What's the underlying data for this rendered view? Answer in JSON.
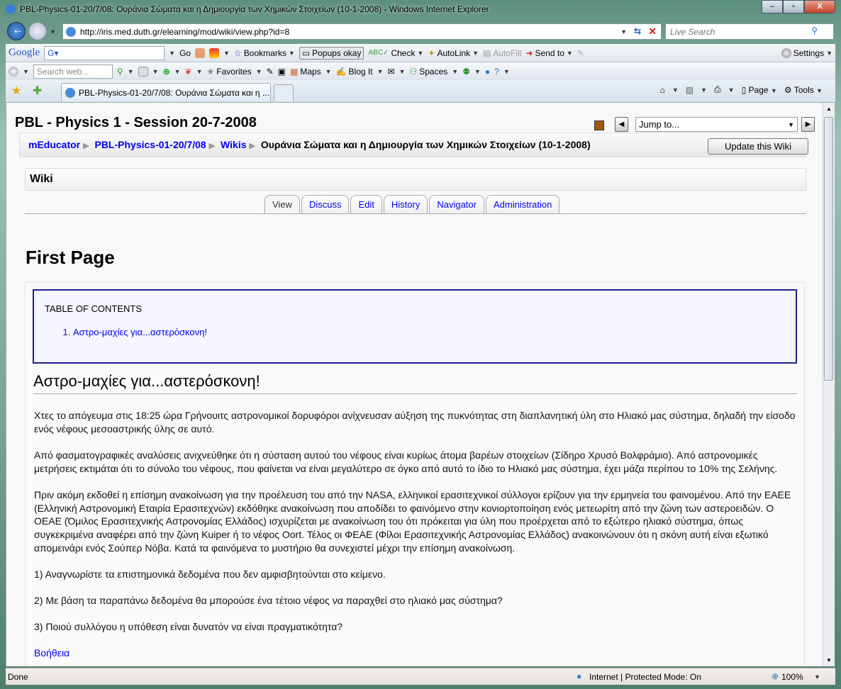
{
  "window": {
    "title": "PBL-Physics-01-20/7/08: Ουράνια Σώματα και η Δημιουργία των Χημικών Στοιχείων (10-1-2008) - Windows Internet Explorer",
    "minimize": "–",
    "maximize": "▫",
    "close": "X"
  },
  "address": {
    "url": "http://iris.med.duth.gr/elearning/mod/wiki/view.php?id=8",
    "search_placeholder": "Live Search"
  },
  "google_toolbar": {
    "logo": "Google",
    "go": "Go",
    "bookmarks": "Bookmarks",
    "popups": "Popups okay",
    "check": "Check",
    "autolink": "AutoLink",
    "autofill": "AutoFill",
    "sendto": "Send to",
    "settings": "Settings"
  },
  "msn_toolbar": {
    "search_placeholder": "Search web...",
    "favorites": "Favorites",
    "maps": "Maps",
    "blogit": "Blog It",
    "spaces": "Spaces"
  },
  "tabs_bar": {
    "tab_title": "PBL-Physics-01-20/7/08: Ουράνια Σώματα και η ...",
    "page": "Page",
    "tools": "Tools"
  },
  "page": {
    "title": "PBL - Physics 1 - Session 20-7-2008",
    "jump_to": "Jump to...",
    "breadcrumb": [
      "mEducator",
      "PBL-Physics-01-20/7/08",
      "Wikis"
    ],
    "breadcrumb_current": "Ουράνια Σώματα και η Δημιουργία των Χημικών Στοιχείων (10-1-2008)",
    "update_button": "Update this Wiki",
    "wiki_heading": "Wiki",
    "tabs": [
      "View",
      "Discuss",
      "Edit",
      "History",
      "Navigator",
      "Administration"
    ],
    "active_tab": "View",
    "page_heading": "First Page",
    "toc_title": "TABLE OF CONTENTS",
    "toc_items": [
      "Αστρο-μαχίες για...αστερόσκονη!"
    ],
    "section_heading": "Αστρο-μαχίες για...αστερόσκονη!",
    "paragraphs": [
      "Χτες το απόγευμα στις 18:25 ώρα Γρήνουιτς αστρονομικοί δορυφόροι ανίχνευσαν αύξηση της πυκνότητας στη διαπλανητική ύλη στο Ηλιακό μας σύστημα, δηλαδή την είσοδο ενός νέφους μεσοαστρικής ύλης σε αυτό.",
      "Από φασματογραφικές αναλύσεις ανιχνεύθηκε ότι η σύσταση αυτού του νέφους είναι κυρίως άτομα βαρέων στοιχείων (Σίδηρο Χρυσό Βολφράμιο). Από αστρονομικές μετρήσεις εκτιμάται ότι το σύνολο του νέφους, που φαίνεται να είναι μεγαλύτερο σε όγκο από αυτό το ίδιο το Ηλιακό μας σύστημα, έχει μάζα περίπου το 10% της Σελήνης.",
      "Πριν ακόμη εκδοθεί η επίσημη ανακοίνωση για την προέλευση του από την NASA, ελληνικοί ερασιτεχνικοί σύλλογοι ερίζουν για την ερμηνεία του φαινομένου. Από την ΕΑΕΕ (Ελληνική Αστρονομική Εταιρία Ερασιτεχνών) εκδόθηκε ανακοίνωση που αποδίδει το φαινόμενο στην κονιορτοποίηση ενός μετεωρίτη από την ζώνη των αστεροειδών. Ο ΟΕΑΕ (Όμιλος Ερασιτεχνικής Αστρονομίας Ελλάδος) ισχυρίζεται με ανακοίνωση του ότι πρόκειται για ύλη που προέρχεται από το εξώτερο ηλιακό σύστημα, όπως συγκεκριμένα αναφέρει από την ζώνη Kuiper ή το νέφος Oort. Τέλος οι ΦΕΑΕ (Φίλοι Ερασιτεχνικής Αστρονομίας Ελλάδος) ανακοινώνουν ότι η σκόνη αυτή είναι εξωτικό απομεινάρι ενός Σούπερ Νόβα. Κατά τα φαινόμενα το μυστήριο θα συνεχιστεί μέχρι την επίσημη ανακοίνωση.",
      "1) Αναγνωρίστε τα επιστημονικά δεδομένα που δεν αμφισβητούνται στο κείμενο.",
      "2) Με βάση τα παραπάνω δεδομένα θα μπορούσε ένα τέτοιο νέφος να παραχθεί στο ηλιακό μας σύστημα?",
      "3) Ποιού συλλόγου η υπόθεση είναι δυνατόν να είναι πραγματικότητα?"
    ],
    "help_link": "Βοήθεια"
  },
  "status": {
    "text": "Done",
    "zone": "Internet | Protected Mode: On",
    "zoom": "100%"
  },
  "colors": {
    "link": "#0000ee",
    "toc_border": "#1f1f8f",
    "toc_bg": "#f5f5ff"
  }
}
